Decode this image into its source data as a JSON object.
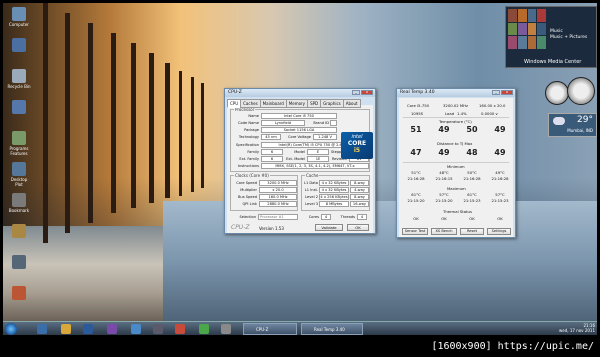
{
  "desktop_icons": [
    {
      "label": "Computer",
      "color": "#6a8fb5"
    },
    {
      "label": "",
      "color": "#4a6fa0"
    },
    {
      "label": "Recycle Bin",
      "color": "#9aaabb"
    },
    {
      "label": "",
      "color": "#5577aa"
    },
    {
      "label": "Programs Features",
      "color": "#7a9a6a"
    },
    {
      "label": "Desktop Plot",
      "color": "#557799"
    },
    {
      "label": "Bookmark",
      "color": "#7a7a7a"
    },
    {
      "label": "",
      "color": "#aa8844"
    },
    {
      "label": "",
      "color": "#556677"
    },
    {
      "label": "",
      "color": "#bb5533"
    }
  ],
  "wmc": {
    "menu": [
      "Music",
      "Music + Pictures"
    ],
    "title": "Windows Media Center"
  },
  "weather": {
    "temp": "29°",
    "city": "Mumbai, IND"
  },
  "cpuz": {
    "title": "CPU-Z",
    "tabs": [
      "CPU",
      "Caches",
      "Mainboard",
      "Memory",
      "SPD",
      "Graphics",
      "About"
    ],
    "processor_label": "Processor",
    "name_label": "Name",
    "name": "Intel Core i5 750",
    "codename_label": "Code Name",
    "codename": "Lynnfield",
    "brand_label": "Brand ID",
    "package_label": "Package",
    "package": "Socket 1156 LGA",
    "tech_label": "Technology",
    "tech": "45 nm",
    "voltage_label": "Core Voltage",
    "voltage": "1.248 V",
    "spec_label": "Specification",
    "spec": "Intel(R) Core(TM) i5 CPU   750  @ 2.67GHz",
    "family_label": "Family",
    "family": "6",
    "model_label": "Model",
    "model": "E",
    "stepping_label": "Stepping",
    "stepping": "5",
    "extfamily_label": "Ext. Family",
    "extfamily": "6",
    "extmodel_label": "Ext. Model",
    "extmodel": "1E",
    "revision_label": "Revision",
    "revision": "B1",
    "instr_label": "Instructions",
    "instr": "MMX, SSE(1, 2, 3, 3S, 4.1, 4.2), EM64T, VT-x",
    "clocks_label": "Clocks (Core #0)",
    "corespeed_label": "Core Speed",
    "corespeed": "3200.0 MHz",
    "mult_label": "Multiplier",
    "mult": "x 20.0",
    "bus_label": "Bus Speed",
    "bus": "160.0 MHz",
    "qpi_label": "QPI Link",
    "qpi": "2880.0 MHz",
    "cache_label": "Cache",
    "l1d_label": "L1 Data",
    "l1d": "4 x 32 KBytes",
    "l1d_w": "8-way",
    "l1i_label": "L1 Inst.",
    "l1i": "4 x 32 KBytes",
    "l1i_w": "4-way",
    "l2_label": "Level 2",
    "l2": "4 x 256 KBytes",
    "l2_w": "8-way",
    "l3_label": "Level 3",
    "l3": "8 MBytes",
    "l3_w": "16-way",
    "selection_label": "Selection",
    "selection": "Processor #1",
    "cores_label": "Cores",
    "cores": "4",
    "threads_label": "Threads",
    "threads": "4",
    "brand_text": "CPU-Z",
    "version": "Version 1.53",
    "validate": "Validate",
    "ok": "OK",
    "intel_logo_line1": "intel",
    "intel_logo_line2": "CORE",
    "intel_logo_line3": "i5"
  },
  "realtemp": {
    "title": "Real Temp 3.40",
    "cpu": "Core i5-750",
    "mhz": "3200.02 MHz",
    "ratio": "160.00 x 20.0",
    "vid": "1095S",
    "load_label": "Load",
    "load": "1.4%",
    "mhz2": "0.0000 v",
    "temp_label": "Temperature (°C)",
    "temps": [
      "51",
      "49",
      "50",
      "49"
    ],
    "tj_label": "Distance to TJ Max",
    "dist": [
      "47",
      "49",
      "48",
      "49"
    ],
    "min_label": "Minimum",
    "mins": [
      "51°C",
      "48°C",
      "50°C",
      "49°C"
    ],
    "min_times": [
      "21:16:28",
      "21:16:15",
      "21:16:28",
      "21:16:28"
    ],
    "max_label": "Maximum",
    "maxs": [
      "61°C",
      "57°C",
      "61°C",
      "57°C"
    ],
    "max_times": [
      "21:15:20",
      "21:15:20",
      "21:15:23",
      "21:15:23"
    ],
    "ok_row": [
      "OK",
      "OK",
      "OK",
      "OK"
    ],
    "status_label": "Thermal Status",
    "buttons": [
      "Sensor Test",
      "XS Bench",
      "Reset",
      "Settings"
    ]
  },
  "taskbar": {
    "tasks": [
      "CPU-Z",
      "Real Temp 3.40"
    ],
    "time": "21:16",
    "date": "wed, 17 nov 2011"
  },
  "footer": "[1600x900] https://upic.me/"
}
